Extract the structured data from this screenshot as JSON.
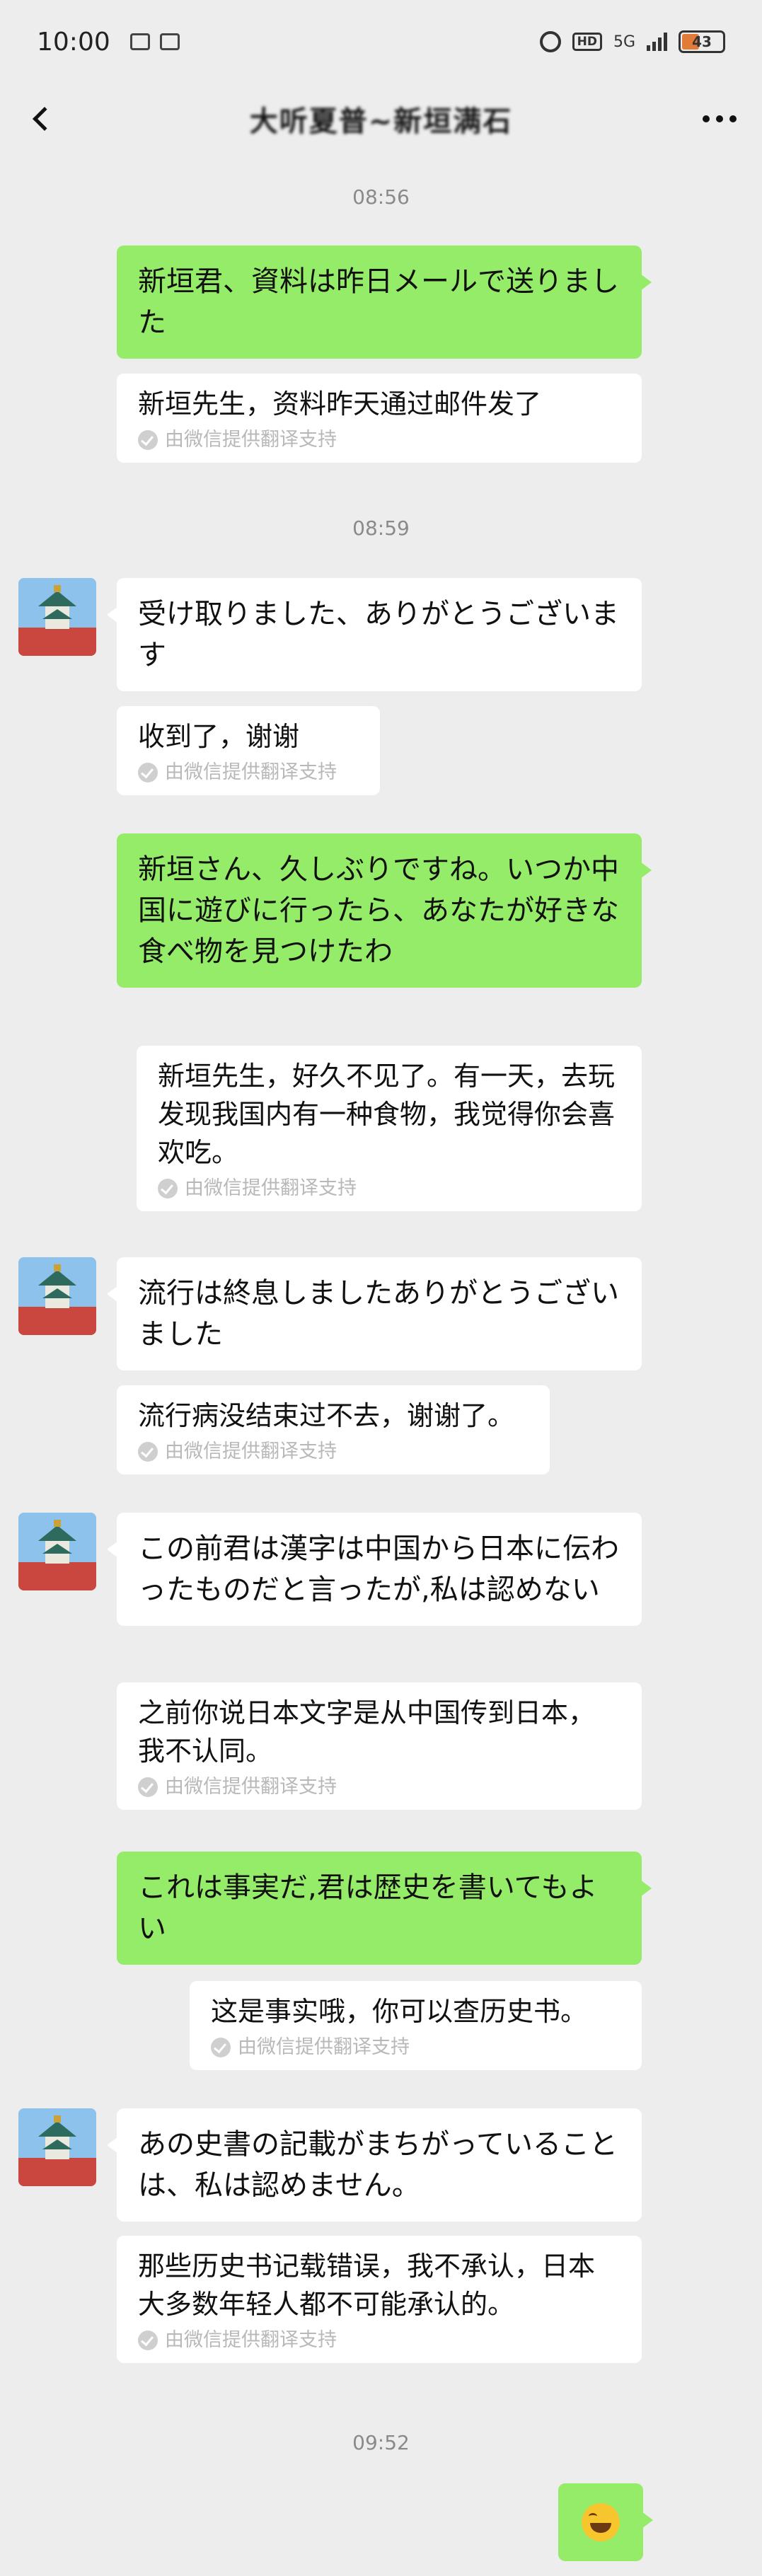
{
  "status_bar": {
    "time": "10:00",
    "network": "5G",
    "hd": "HD",
    "battery": "43"
  },
  "header": {
    "title": "大听夏普~新垣满石"
  },
  "timestamps": [
    "08:56",
    "08:59",
    "09:52"
  ],
  "translation_note": "由微信提供翻译支持",
  "messages": [
    {
      "sender": "me",
      "text": "新垣君、資料は昨日メールで送りました"
    },
    {
      "sender": "me-translation",
      "text": "新垣先生，资料昨天通过邮件发了"
    },
    {
      "sender": "them",
      "text": "受け取りました、ありがとうございます"
    },
    {
      "sender": "them-translation",
      "text": "收到了，谢谢"
    },
    {
      "sender": "me",
      "text": "新垣さん、久しぶりですね。いつか中国に遊びに行ったら、あなたが好きな食べ物を見つけたわ"
    },
    {
      "sender": "me-translation",
      "text": "新垣先生，好久不见了。有一天，去玩发现我国内有一种食物，我觉得你会喜欢吃。"
    },
    {
      "sender": "them",
      "text": "流行は終息しましたありがとうございました"
    },
    {
      "sender": "them-translation",
      "text": "流行病没结束过不去，谢谢了。"
    },
    {
      "sender": "them",
      "text": "この前君は漢字は中国から日本に伝わったものだと言ったが,私は認めない"
    },
    {
      "sender": "them-translation",
      "text": "之前你说日本文字是从中国传到日本，我不认同。"
    },
    {
      "sender": "me",
      "text": "これは事実だ,君は歴史を書いてもよい"
    },
    {
      "sender": "me-translation",
      "text": "这是事实哦，你可以查历史书。"
    },
    {
      "sender": "them",
      "text": "あの史書の記載がまちがっていることは、私は認めません。"
    },
    {
      "sender": "them-translation",
      "text": "那些历史书记载错误，我不承认，日本大多数年轻人都不可能承认的。"
    },
    {
      "sender": "me",
      "text": "",
      "emoji": "laugh-cry-emoji"
    }
  ]
}
